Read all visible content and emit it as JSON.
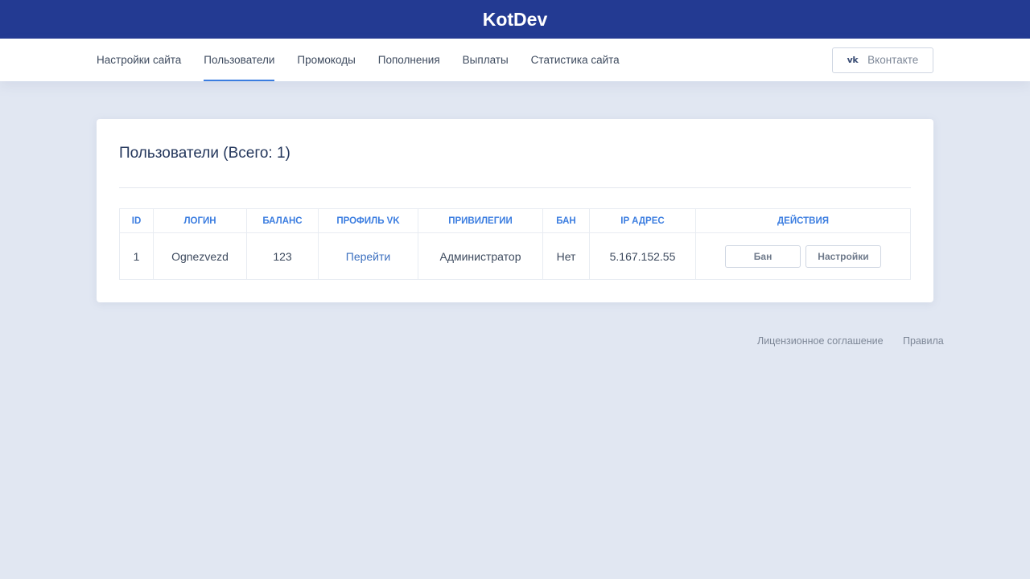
{
  "header": {
    "brand": "KotDev"
  },
  "nav": {
    "items": [
      {
        "label": "Настройки сайта"
      },
      {
        "label": "Пользователи"
      },
      {
        "label": "Промокоды"
      },
      {
        "label": "Пополнения"
      },
      {
        "label": "Выплаты"
      },
      {
        "label": "Статистика сайта"
      }
    ],
    "active_index": 1,
    "vk_icon": "vk-icon",
    "vk_label": "Вконтакте"
  },
  "users": {
    "title": "Пользователи (Всего: 1)",
    "columns": [
      "ID",
      "Логин",
      "Баланс",
      "Профиль VK",
      "Привилегии",
      "Бан",
      "IP адрес",
      "Действия"
    ],
    "rows": [
      {
        "id": "1",
        "login": "Ognezvezd",
        "balance": "123",
        "vk_profile": "Перейти",
        "privileges": "Администратор",
        "ban": "Нет",
        "ip": "5.167.152.55",
        "ban_button": "Бан",
        "settings_button": "Настройки"
      }
    ]
  },
  "footer": {
    "license": "Лицензионное соглашение",
    "rules": "Правила"
  },
  "colors": {
    "topbar": "#233a92",
    "accent": "#3b7de0",
    "background": "#e1e7f2"
  }
}
